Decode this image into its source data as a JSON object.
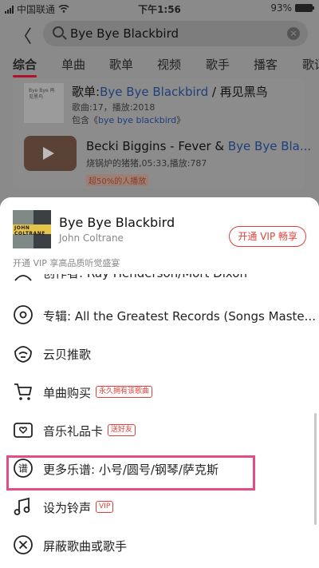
{
  "status_bar": {
    "carrier": "中国联通",
    "time": "下午1:56",
    "battery": "93%"
  },
  "search": {
    "query": "Bye Bye Blackbird",
    "clear_symbol": "×"
  },
  "nav": {
    "back_symbol": "〈"
  },
  "tabs": [
    {
      "label": "综合"
    },
    {
      "label": "单曲"
    },
    {
      "label": "歌单"
    },
    {
      "label": "视频"
    },
    {
      "label": "歌手"
    },
    {
      "label": "播客"
    },
    {
      "label": "歌词"
    }
  ],
  "results": {
    "playlist": {
      "cover_text": "Bye Bye 再见黑鸟",
      "prefix": "歌单:",
      "title_highlight": "Bye Bye Blackbird",
      "title_suffix": " / 再见黑鸟",
      "meta": "歌曲:17，播放:2018",
      "contains_prefix": "包含《",
      "contains_highlight": "bye bye blackbird",
      "contains_suffix": "》"
    },
    "video": {
      "title_prefix": "Becki Biggins - Fever & ",
      "title_highlight": "Bye Bye Bla...",
      "meta": "烧锅炉的猪猪,05:33,播放:787",
      "badge": "超50%的人播放"
    }
  },
  "sheet": {
    "song": {
      "title": "Bye Bye Blackbird",
      "artist": "John Coltrane",
      "art_text": "JOHN COLTRANE"
    },
    "vip_button": "开通 VIP 畅享",
    "vip_hint": "开通 VIP 享高品质听觉盛宴",
    "menu": [
      {
        "label": "创作者: Ray Henderson/Mort Dixon",
        "icon": "creator-icon"
      },
      {
        "label": "专辑: All the Greatest Records (Songs Maste...",
        "icon": "album-disc-icon"
      },
      {
        "label": "云贝推歌",
        "icon": "cloud-shell-icon"
      },
      {
        "label": "单曲购买",
        "icon": "cart-icon",
        "tag": "永久拥有该歌曲"
      },
      {
        "label": "音乐礼品卡",
        "icon": "gift-card-icon",
        "tag": "送好友"
      },
      {
        "label": "更多乐谱: 小号/圆号/钢琴/萨克斯",
        "icon": "sheet-music-icon"
      },
      {
        "label": "设为铃声",
        "icon": "ringtone-icon",
        "tag": "VIP"
      },
      {
        "label": "屏蔽歌曲或歌手",
        "icon": "block-icon"
      }
    ]
  },
  "colors": {
    "accent_red": "#e0403a",
    "highlight_pink": "#e34b89"
  }
}
